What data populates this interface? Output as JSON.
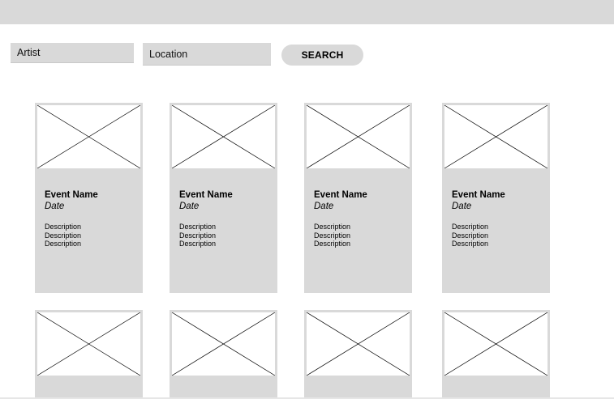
{
  "search": {
    "artist_label": "Artist",
    "location_label": "Location",
    "button_label": "SEARCH"
  },
  "events": [
    {
      "name": "Event Name",
      "date": "Date",
      "description": [
        "Description",
        "Description",
        "Description"
      ]
    },
    {
      "name": "Event Name",
      "date": "Date",
      "description": [
        "Description",
        "Description",
        "Description"
      ]
    },
    {
      "name": "Event Name",
      "date": "Date",
      "description": [
        "Description",
        "Description",
        "Description"
      ]
    },
    {
      "name": "Event Name",
      "date": "Date",
      "description": [
        "Description",
        "Description",
        "Description"
      ]
    },
    {
      "name": "",
      "date": "",
      "description": []
    },
    {
      "name": "",
      "date": "",
      "description": []
    },
    {
      "name": "",
      "date": "",
      "description": []
    },
    {
      "name": "",
      "date": "",
      "description": []
    }
  ],
  "colors": {
    "placeholder_fill": "#d9d9d9",
    "background": "#ffffff"
  }
}
